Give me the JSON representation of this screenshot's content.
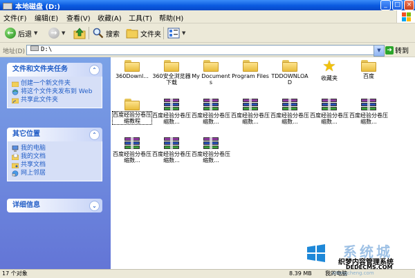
{
  "window": {
    "title": "本地磁盘 (D:)",
    "buttons": {
      "minimize": "_",
      "maximize": "□",
      "close": "×"
    }
  },
  "menu": [
    "文件(F)",
    "编辑(E)",
    "查看(V)",
    "收藏(A)",
    "工具(T)",
    "帮助(H)"
  ],
  "toolbar": {
    "back": "后退",
    "search": "搜索",
    "folders": "文件夹"
  },
  "address": {
    "label": "地址(D)",
    "value": "D:\\",
    "go": "转到"
  },
  "sidebar": {
    "tasks": {
      "title": "文件和文件夹任务",
      "items": [
        "创建一个新文件夹",
        "将这个文件夹发布到 Web",
        "共享此文件夹"
      ]
    },
    "places": {
      "title": "其它位置",
      "items": [
        "我的电脑",
        "我的文档",
        "共享文档",
        "网上邻居"
      ]
    },
    "details": {
      "title": "详细信息"
    }
  },
  "files": [
    {
      "name": "360Downl...",
      "type": "folder"
    },
    {
      "name": "360安全浏览器下载",
      "type": "folder"
    },
    {
      "name": "My Documents",
      "type": "folder"
    },
    {
      "name": "Program Files",
      "type": "folder"
    },
    {
      "name": "TDDOWNLOAD",
      "type": "folder"
    },
    {
      "name": "收藏夹",
      "type": "star"
    },
    {
      "name": "百度",
      "type": "folder"
    },
    {
      "name": "百度经验分卷压缩教程",
      "type": "folder",
      "selected": true
    },
    {
      "name": "百度经验分卷压缩数...",
      "type": "rar"
    },
    {
      "name": "百度经验分卷压缩数...",
      "type": "rar"
    },
    {
      "name": "百度经验分卷压缩数...",
      "type": "rar"
    },
    {
      "name": "百度经验分卷压缩数...",
      "type": "rar"
    },
    {
      "name": "百度经验分卷压缩数...",
      "type": "rar"
    },
    {
      "name": "百度经验分卷压缩数...",
      "type": "rar"
    },
    {
      "name": "百度经验分卷压缩数...",
      "type": "rar"
    },
    {
      "name": "百度经验分卷压缩数...",
      "type": "rar"
    },
    {
      "name": "百度经验分卷压缩数...",
      "type": "rar"
    }
  ],
  "status": {
    "count": "17 个对象",
    "size": "8.39 MB",
    "location": "我的电脑"
  },
  "watermark": {
    "brand": "系统城",
    "line1": "织梦内容管理系统",
    "line2": "DEDECMS.COM",
    "line3": "xitongcheng.com"
  },
  "colors": {
    "titlebar": "#0a5ae0",
    "sidebar": "#6375d6",
    "link": "#215dc6"
  }
}
